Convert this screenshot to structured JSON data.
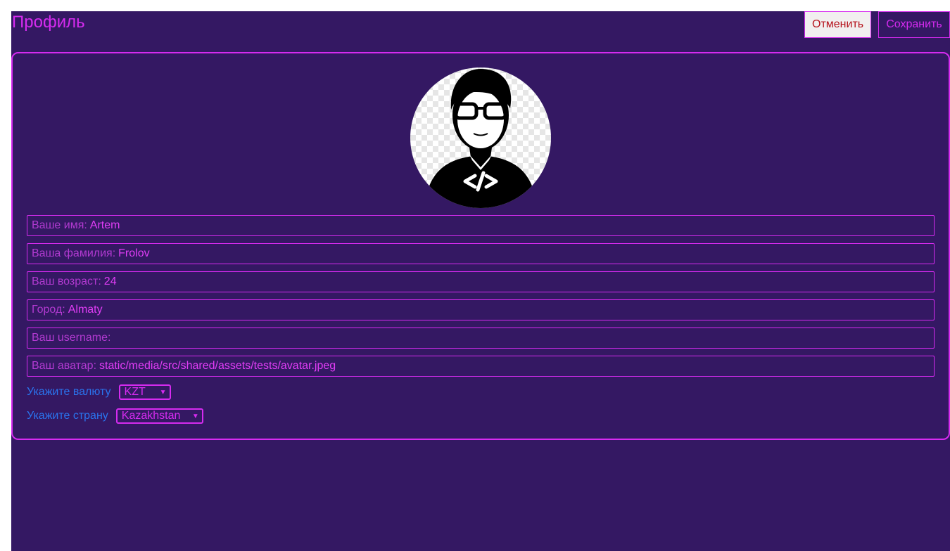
{
  "header": {
    "title": "Профиль",
    "cancel_label": "Отменить",
    "save_label": "Сохранить"
  },
  "profile": {
    "avatar_icon": "developer-avatar-icon",
    "fields": [
      {
        "label": "Ваше имя:",
        "value": "Artem"
      },
      {
        "label": "Ваша фамилия:",
        "value": "Frolov"
      },
      {
        "label": "Ваш возраст:",
        "value": "24"
      },
      {
        "label": "Город:",
        "value": "Almaty"
      },
      {
        "label": "Ваш username:",
        "value": ""
      },
      {
        "label": "Ваш аватар:",
        "value": "static/media/src/shared/assets/tests/avatar.jpeg"
      }
    ],
    "currency": {
      "label": "Укажите валюту",
      "selected": "KZT"
    },
    "country": {
      "label": "Укажите страну",
      "selected": "Kazakhstan"
    }
  },
  "colors": {
    "background": "#341863",
    "accent": "#d62bf0",
    "label_blue": "#2a74ee",
    "cancel_text": "#b5121b"
  }
}
